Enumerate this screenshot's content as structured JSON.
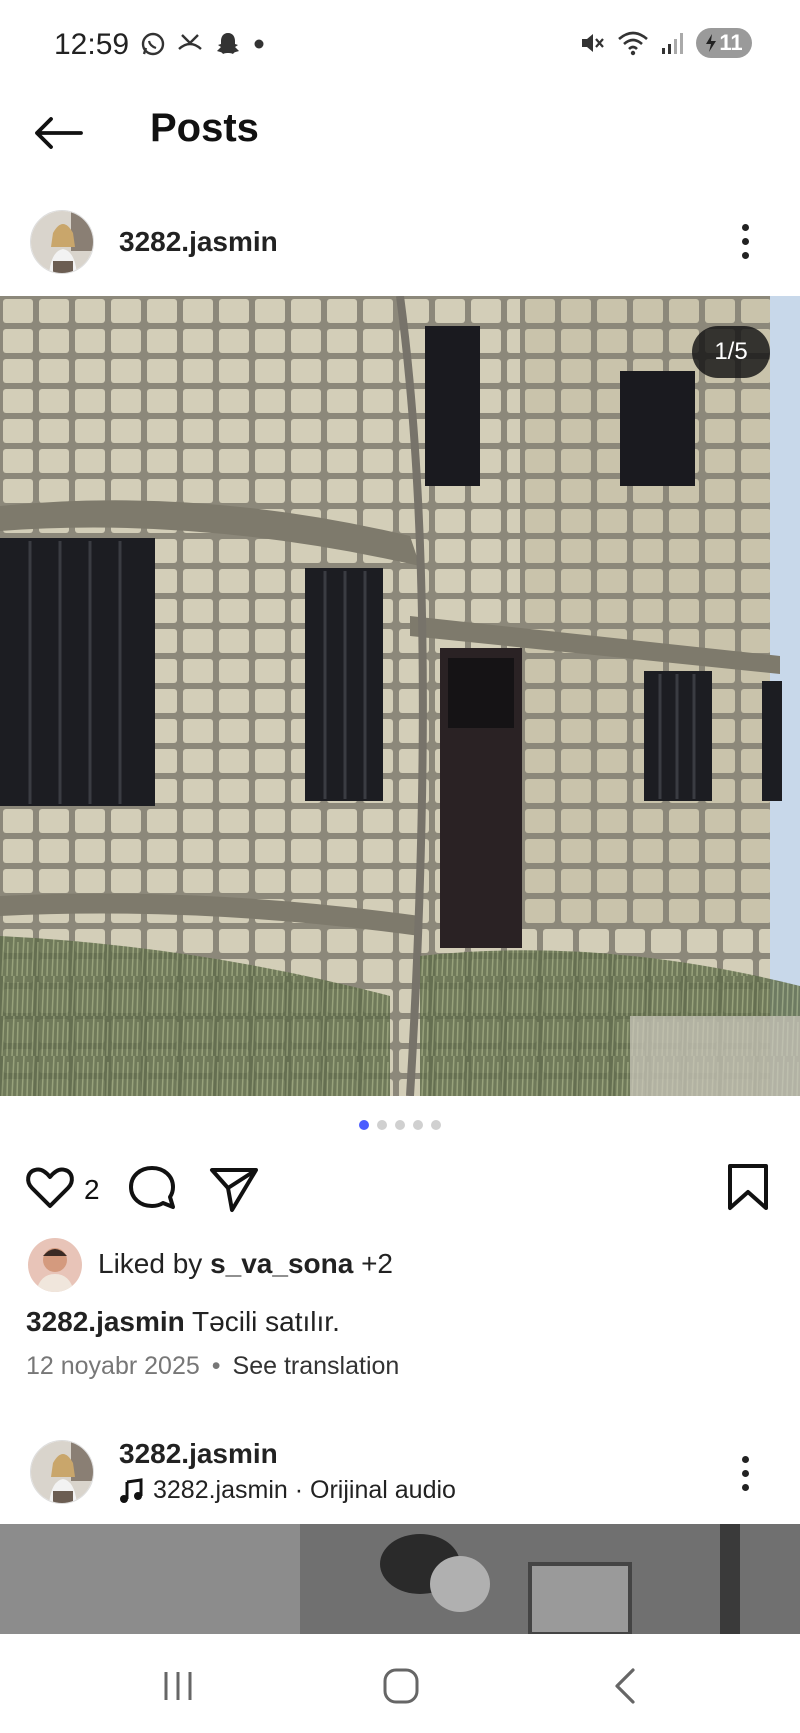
{
  "status_bar": {
    "time": "12:59",
    "battery": "11",
    "left_icons": [
      "whatsapp-icon",
      "missed-call-icon",
      "snapchat-icon",
      "dot-icon"
    ],
    "right_icons": [
      "mute-icon",
      "wifi-icon",
      "signal-icon",
      "battery-icon"
    ]
  },
  "header": {
    "title": "Posts",
    "back_icon": "arrow-left-icon"
  },
  "post": {
    "username": "3282.jasmin",
    "image_counter": "1/5",
    "image_count": 5,
    "active_image_index": 0,
    "like_count": "2",
    "liked_by_prefix": "Liked by ",
    "liked_by_user": "s_va_sona",
    "liked_by_suffix": " +2",
    "caption_user": "3282.jasmin",
    "caption_text": " Təcili satılır.",
    "date": "12 noyabr 2025",
    "separator": "•",
    "see_translation": "See translation"
  },
  "next_post": {
    "username": "3282.jasmin",
    "audio": "3282.jasmin · Orijinal audio"
  },
  "colors": {
    "accent_dot": "#4a5cff",
    "counter_bg": "#141414"
  }
}
